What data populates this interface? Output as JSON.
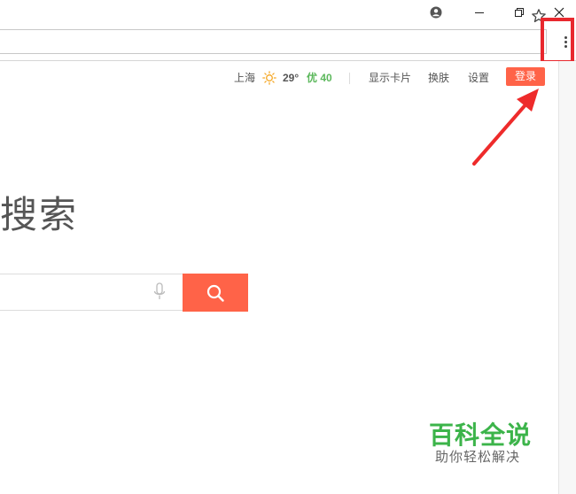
{
  "titlebar": {
    "account_icon": "account-circle-icon",
    "minimize_icon": "minimize-icon",
    "restore_icon": "restore-icon",
    "close_icon": "close-icon"
  },
  "toolbar": {
    "url": "",
    "bookmark_icon": "star-icon",
    "menu_icon": "more-vertical-icon"
  },
  "topnav": {
    "city": "上海",
    "weather_icon": "sun-icon",
    "temperature": "29°",
    "air_quality": "优 40",
    "show_card": "显示卡片",
    "skin": "换肤",
    "settings": "设置",
    "login": "登录"
  },
  "main": {
    "headline": "搜索",
    "search": {
      "value": "",
      "placeholder": "",
      "mic_icon": "microphone-icon",
      "button_icon": "search-icon"
    }
  },
  "watermark": {
    "title": "百科全说",
    "subtitle": "助你轻松解决"
  },
  "colors": {
    "accent": "#ff6348",
    "highlight_box": "#e8282e",
    "aqi_good": "#5cb85c",
    "watermark_green": "#3cb44a"
  }
}
